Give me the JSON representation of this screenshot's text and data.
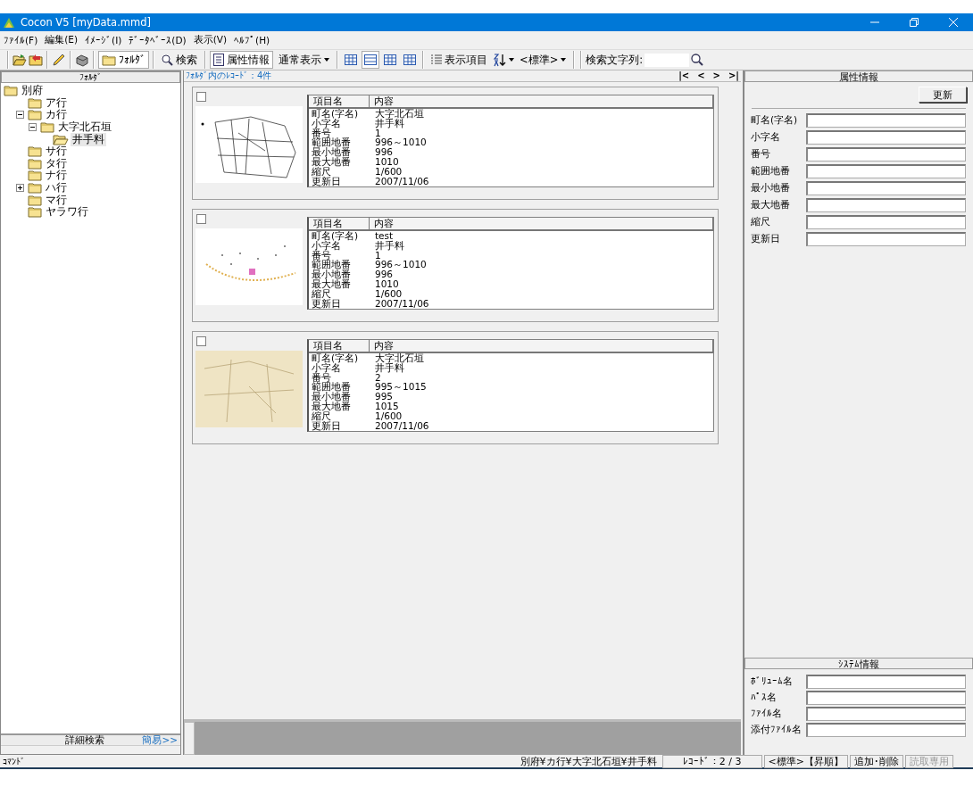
{
  "window": {
    "title": "Cocon V5 [myData.mmd]"
  },
  "menu": [
    "ﾌｧｲﾙ(F)",
    "編集(E)",
    "ｲﾒｰｼﾞ(I)",
    "ﾃﾞｰﾀﾍﾞｰｽ(D)",
    "表示(V)",
    "ﾍﾙﾌﾟ(H)"
  ],
  "toolbar": {
    "folder_button": {
      "label": "ﾌｫﾙﾀﾞ",
      "selected": true
    },
    "search_button": {
      "label": "検索",
      "selected": false
    },
    "attributes_button": {
      "label": "属性情報",
      "selected": true
    },
    "view_dropdown": {
      "label": "通常表示"
    },
    "view_modes": [
      {
        "selected": false
      },
      {
        "selected": true
      },
      {
        "selected": false
      },
      {
        "selected": false
      }
    ],
    "display_items_button": {
      "label": "表示項目"
    },
    "sort_dropdown": {
      "label": "<標準>"
    },
    "search_label": "検索文字列:"
  },
  "folder_panel": {
    "title": "ﾌｫﾙﾀﾞ",
    "tree": [
      {
        "label": "別府",
        "selected": false,
        "children": [
          {
            "label": "ア行",
            "selected": false
          },
          {
            "label": "カ行",
            "expanded": true,
            "selected": false,
            "children": [
              {
                "label": "大字北石垣",
                "expanded": true,
                "selected": false,
                "children": [
                  {
                    "label": "井手料",
                    "selected": true
                  }
                ]
              }
            ]
          },
          {
            "label": "サ行",
            "selected": false
          },
          {
            "label": "タ行",
            "selected": false
          },
          {
            "label": "ナ行",
            "selected": false
          },
          {
            "label": "ハ行",
            "expanded": false,
            "selected": false
          },
          {
            "label": "マ行",
            "selected": false
          },
          {
            "label": "ヤラワ行",
            "selected": false
          }
        ]
      }
    ],
    "search_title": "詳細検索",
    "simple_link": "簡易>>"
  },
  "records_panel": {
    "title": "ﾌｫﾙﾀﾞ内のﾚｺｰﾄﾞ：4件",
    "nav": [
      "|<",
      "<",
      ">",
      ">|"
    ],
    "records": [
      {
        "checked": false,
        "kind": "line-map",
        "columns": [
          "項目名",
          "内容"
        ],
        "rows": [
          [
            "町名(字名)",
            "大字北石垣"
          ],
          [
            "小字名",
            "井手料"
          ],
          [
            "番号",
            "1"
          ],
          [
            "範囲地番",
            "996～1010"
          ],
          [
            "最小地番",
            "996"
          ],
          [
            "最大地番",
            "1010"
          ],
          [
            "縮尺",
            "1/600"
          ],
          [
            "更新日",
            "2007/11/06"
          ]
        ]
      },
      {
        "checked": false,
        "kind": "dot-map",
        "columns": [
          "項目名",
          "内容"
        ],
        "rows": [
          [
            "町名(字名)",
            "test"
          ],
          [
            "小字名",
            "井手料"
          ],
          [
            "番号",
            "1"
          ],
          [
            "範囲地番",
            "996～1010"
          ],
          [
            "最小地番",
            "996"
          ],
          [
            "最大地番",
            "1010"
          ],
          [
            "縮尺",
            "1/600"
          ],
          [
            "更新日",
            "2007/11/06"
          ]
        ]
      },
      {
        "checked": false,
        "kind": "aged-map",
        "columns": [
          "項目名",
          "内容"
        ],
        "rows": [
          [
            "町名(字名)",
            "大字北石垣"
          ],
          [
            "小字名",
            "井手料"
          ],
          [
            "番号",
            "2"
          ],
          [
            "範囲地番",
            "995～1015"
          ],
          [
            "最小地番",
            "995"
          ],
          [
            "最大地番",
            "1015"
          ],
          [
            "縮尺",
            "1/600"
          ],
          [
            "更新日",
            "2007/11/06"
          ]
        ]
      }
    ]
  },
  "attributes_panel": {
    "title": "属性情報",
    "update_button": "更新",
    "fields": [
      {
        "label": "町名(字名)"
      },
      {
        "label": "小字名"
      },
      {
        "label": "番号"
      },
      {
        "label": "範囲地番"
      },
      {
        "label": "最小地番"
      },
      {
        "label": "最大地番"
      },
      {
        "label": "縮尺"
      },
      {
        "label": "更新日"
      }
    ]
  },
  "system_panel": {
    "title": "ｼｽﾃﾑ情報",
    "fields": [
      {
        "label": "ﾎﾞﾘｭｰﾑ名"
      },
      {
        "label": "ﾊﾟｽ名"
      },
      {
        "label": "ﾌｧｲﾙ名"
      },
      {
        "label": "添付ﾌｧｲﾙ名"
      }
    ]
  },
  "status_bar": {
    "command": "ｺﾏﾝﾄﾞ",
    "path": "別府¥カ行¥大字北石垣¥井手料",
    "record": "ﾚｺｰﾄﾞ：2 / 3",
    "sort": "<標準>【昇順】",
    "sections": [
      {
        "label": "追加･削除",
        "disabled": false
      },
      {
        "label": "読取専用",
        "disabled": true
      }
    ]
  }
}
